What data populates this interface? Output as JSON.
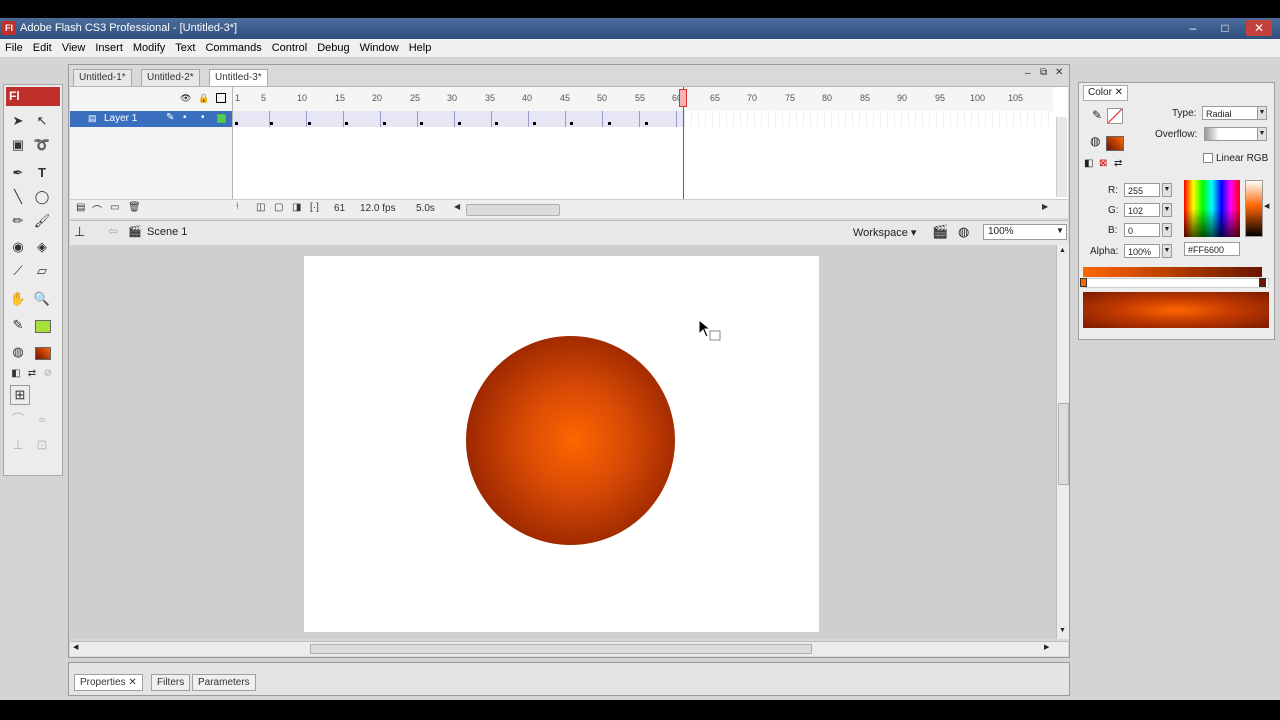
{
  "window": {
    "app_icon": "Fl",
    "title": "Adobe Flash CS3 Professional - [Untitled-3*]",
    "controls": {
      "minimize": "–",
      "maximize": "□",
      "close": "✕"
    }
  },
  "menubar": {
    "items": [
      "File",
      "Edit",
      "View",
      "Insert",
      "Modify",
      "Text",
      "Commands",
      "Control",
      "Debug",
      "Window",
      "Help"
    ]
  },
  "tools": {
    "logo": "Fl",
    "text_tool": "T"
  },
  "documents": {
    "tabs": [
      "Untitled-1*",
      "Untitled-2*",
      "Untitled-3*"
    ],
    "active_index": 2
  },
  "timeline": {
    "layer_name": "Layer 1",
    "frame_ticks": [
      "1",
      "5",
      "10",
      "15",
      "20",
      "25",
      "30",
      "35",
      "40",
      "45",
      "50",
      "55",
      "60",
      "65",
      "70",
      "75",
      "80",
      "85",
      "90",
      "95",
      "100",
      "105"
    ],
    "current_frame": "61",
    "frame_rate": "12.0 fps",
    "elapsed_time": "5.0s"
  },
  "editbar": {
    "scene": "Scene 1",
    "workspace_label": "Workspace ▾",
    "zoom": "100%"
  },
  "properties": {
    "tabs": [
      "Properties",
      "Filters",
      "Parameters"
    ]
  },
  "color_panel": {
    "tab": "Color",
    "type_label": "Type:",
    "type_value": "Radial",
    "overflow_label": "Overflow:",
    "linear_rgb_label": "Linear RGB",
    "r_label": "R:",
    "r_value": "255",
    "g_label": "G:",
    "g_value": "102",
    "b_label": "B:",
    "b_value": "0",
    "alpha_label": "Alpha:",
    "alpha_value": "100%",
    "hex_value": "#FF6600"
  },
  "colors": {
    "fill": "#FF6600",
    "gradient_dark": "#6A1500",
    "accent": "#C0302A"
  }
}
